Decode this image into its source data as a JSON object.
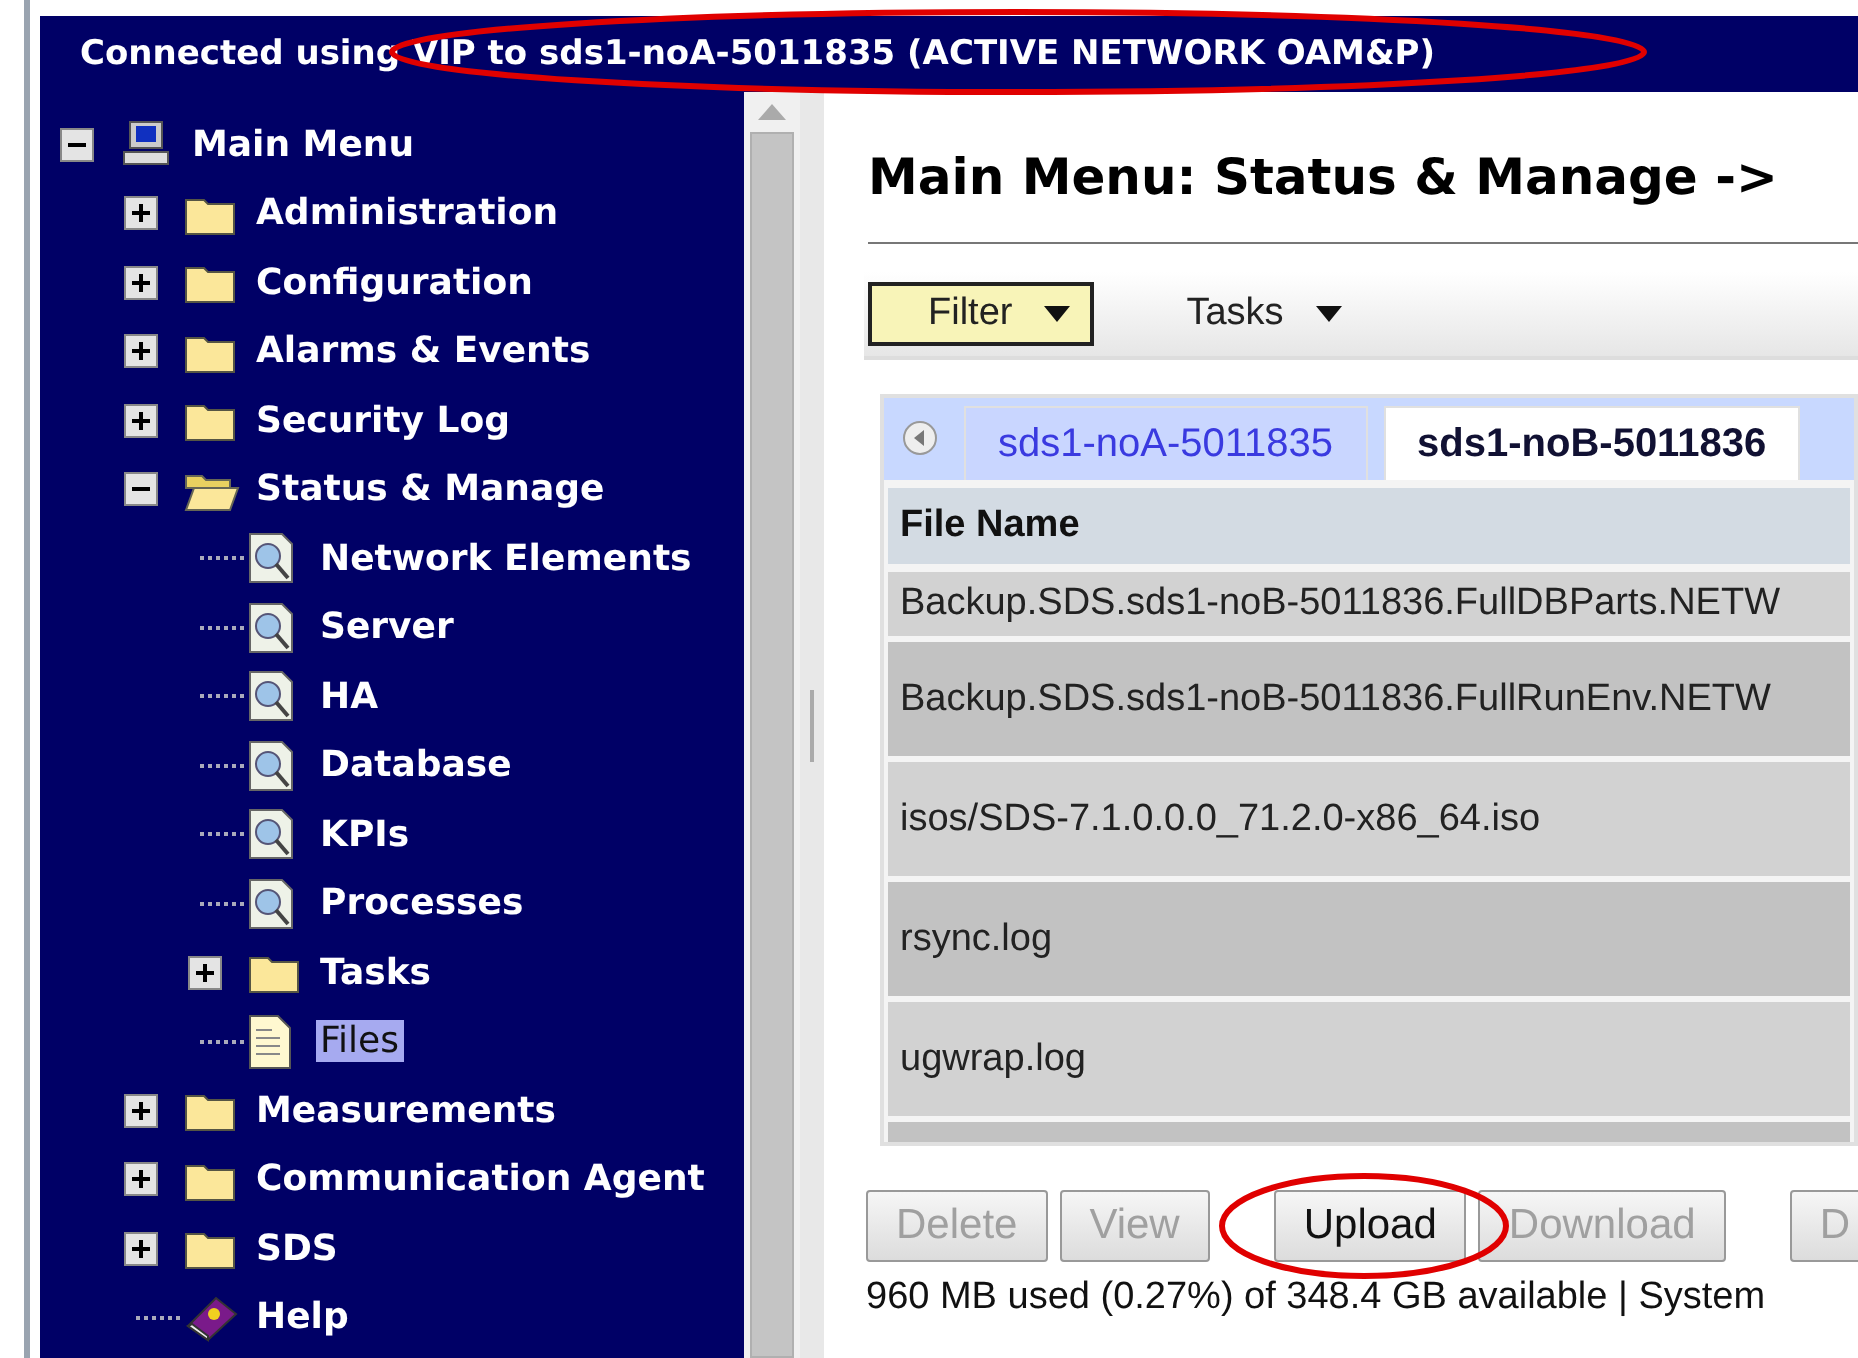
{
  "connection_bar": {
    "text": "Connected using VIP to sds1-noA-5011835 (ACTIVE NETWORK OAM&P)"
  },
  "tree": [
    {
      "label": "Main Menu",
      "kind": "computer",
      "expanded": true,
      "selected": false,
      "children": [
        {
          "label": "Administration",
          "kind": "folder",
          "expanded": false,
          "selected": false
        },
        {
          "label": "Configuration",
          "kind": "folder",
          "expanded": false,
          "selected": false
        },
        {
          "label": "Alarms & Events",
          "kind": "folder",
          "expanded": false,
          "selected": false
        },
        {
          "label": "Security Log",
          "kind": "folder",
          "expanded": false,
          "selected": false
        },
        {
          "label": "Status & Manage",
          "kind": "folder",
          "expanded": true,
          "selected": false,
          "children": [
            {
              "label": "Network Elements",
              "kind": "page",
              "selected": false
            },
            {
              "label": "Server",
              "kind": "page",
              "selected": false
            },
            {
              "label": "HA",
              "kind": "page",
              "selected": false
            },
            {
              "label": "Database",
              "kind": "page",
              "selected": false
            },
            {
              "label": "KPIs",
              "kind": "page",
              "selected": false
            },
            {
              "label": "Processes",
              "kind": "page",
              "selected": false
            },
            {
              "label": "Tasks",
              "kind": "folder",
              "expanded": false,
              "selected": false
            },
            {
              "label": "Files",
              "kind": "file",
              "selected": true
            }
          ]
        },
        {
          "label": "Measurements",
          "kind": "folder",
          "expanded": false,
          "selected": false
        },
        {
          "label": "Communication Agent",
          "kind": "folder",
          "expanded": false,
          "selected": false
        },
        {
          "label": "SDS",
          "kind": "folder",
          "expanded": false,
          "selected": false
        },
        {
          "label": "Help",
          "kind": "help",
          "selected": false
        }
      ]
    }
  ],
  "page_title": "Main Menu: Status & Manage ->",
  "toolbar": [
    {
      "label": "Filter",
      "selected": true
    },
    {
      "label": "Tasks",
      "selected": false
    }
  ],
  "tabs": [
    {
      "label": "sds1-noA-5011835",
      "selected": false
    },
    {
      "label": "sds1-noB-5011836",
      "selected": true
    }
  ],
  "table": {
    "columns": [
      "File Name"
    ],
    "rows": [
      {
        "file_name": "Backup.SDS.sds1-noB-5011836.FullDBParts.NETW"
      },
      {
        "file_name": "Backup.SDS.sds1-noB-5011836.FullRunEnv.NETW"
      },
      {
        "file_name": "isos/SDS-7.1.0.0.0_71.2.0-x86_64.iso"
      },
      {
        "file_name": "rsync.log"
      },
      {
        "file_name": "ugwrap.log"
      }
    ]
  },
  "buttons": [
    {
      "label": "Delete",
      "disabled": true
    },
    {
      "label": "View",
      "disabled": true
    },
    {
      "label": "Upload",
      "disabled": false
    },
    {
      "label": "Download",
      "disabled": true
    },
    {
      "label": "D",
      "disabled": true
    }
  ],
  "status_text": "960 MB used (0.27%) of 348.4 GB available | System"
}
